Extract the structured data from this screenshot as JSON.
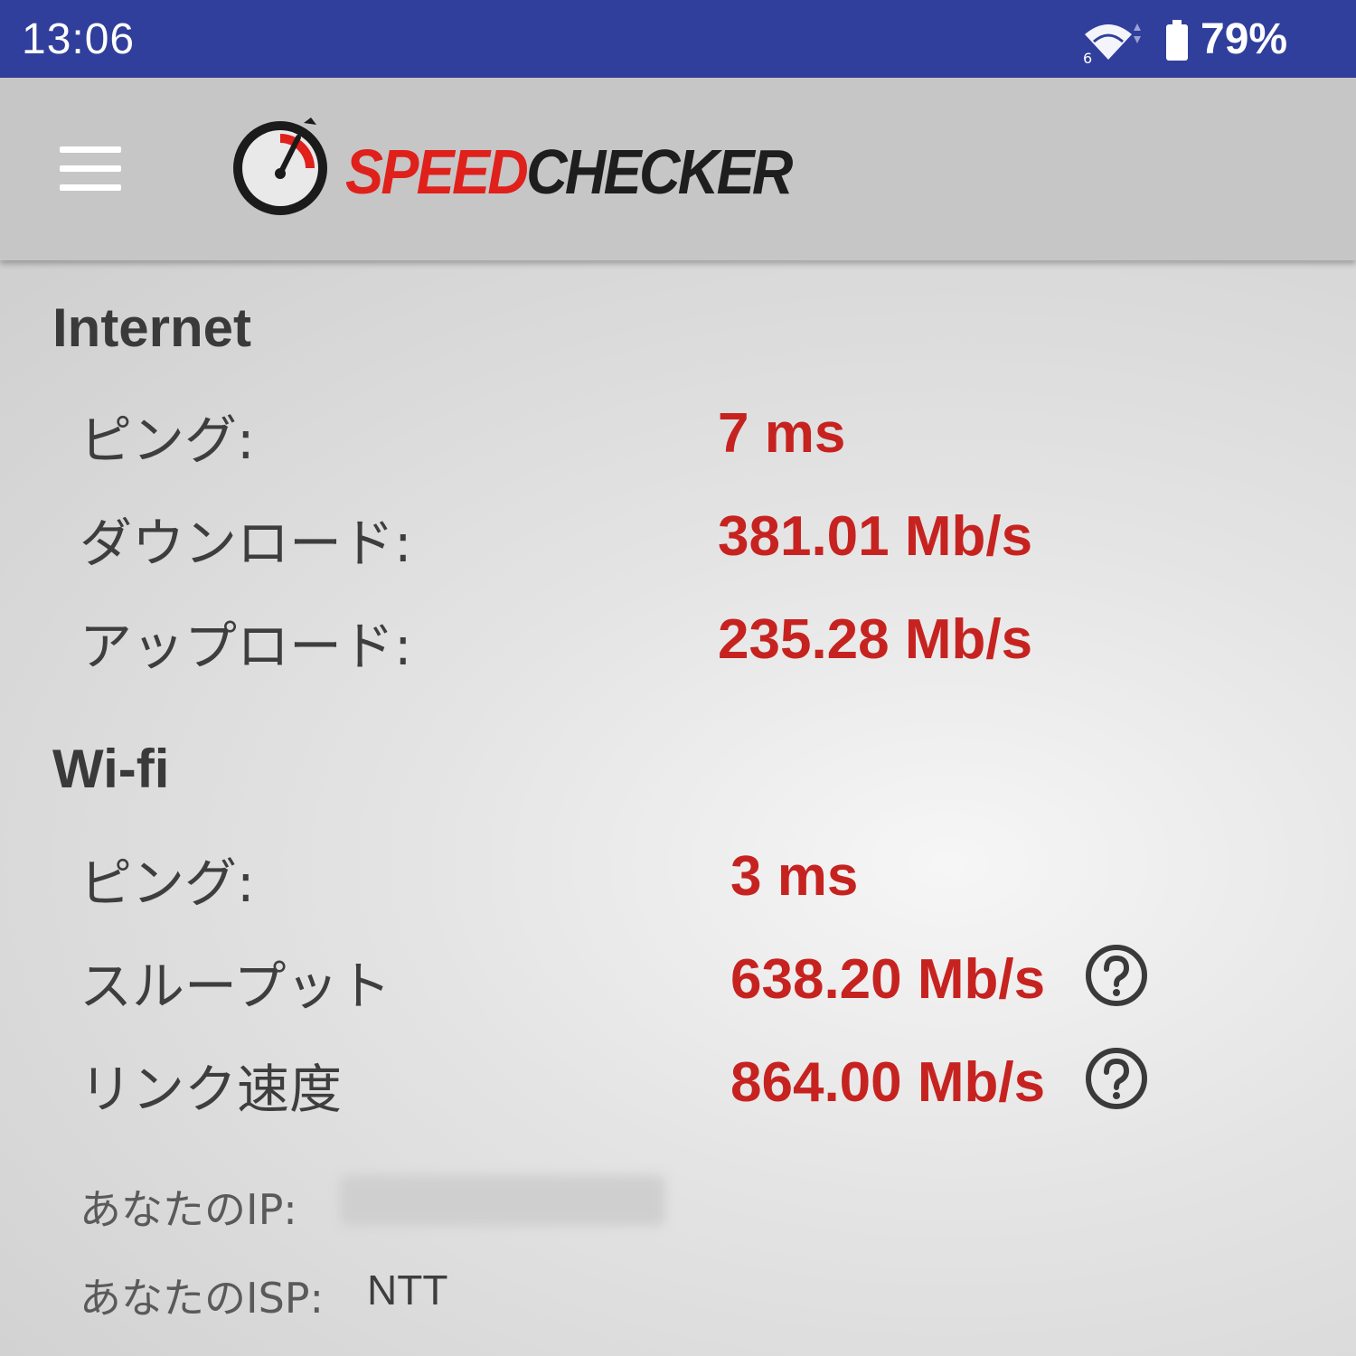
{
  "status_bar": {
    "time": "13:06",
    "wifi_icon": "wifi-6-icon",
    "battery_icon": "battery-icon",
    "battery_percent": "79%"
  },
  "app_bar": {
    "menu_icon": "hamburger-menu-icon",
    "logo_icon": "speedometer-gauge-icon",
    "logo_text_1": "SPEED",
    "logo_text_2": "CHECKER"
  },
  "internet": {
    "title": "Internet",
    "rows": [
      {
        "label": "ピング:",
        "value": "7 ms"
      },
      {
        "label": "ダウンロード:",
        "value": "381.01 Mb/s"
      },
      {
        "label": "アップロード:",
        "value": "235.28 Mb/s"
      }
    ]
  },
  "wifi": {
    "title": "Wi-fi",
    "rows": [
      {
        "label": "ピング:",
        "value": "3 ms"
      },
      {
        "label": "スループット",
        "value": "638.20 Mb/s",
        "icon": "help-icon"
      },
      {
        "label": "リンク速度",
        "value": "864.00 Mb/s",
        "icon": "help-icon"
      }
    ]
  },
  "info": {
    "ip_label": "あなたのIP:",
    "isp_label": "あなたのISP:",
    "isp_value": "NTT"
  },
  "colors": {
    "status_bar": "#303f9c",
    "app_bar": "#c6c6c6",
    "accent_red": "#c62320",
    "logo_red": "#e0201b"
  }
}
